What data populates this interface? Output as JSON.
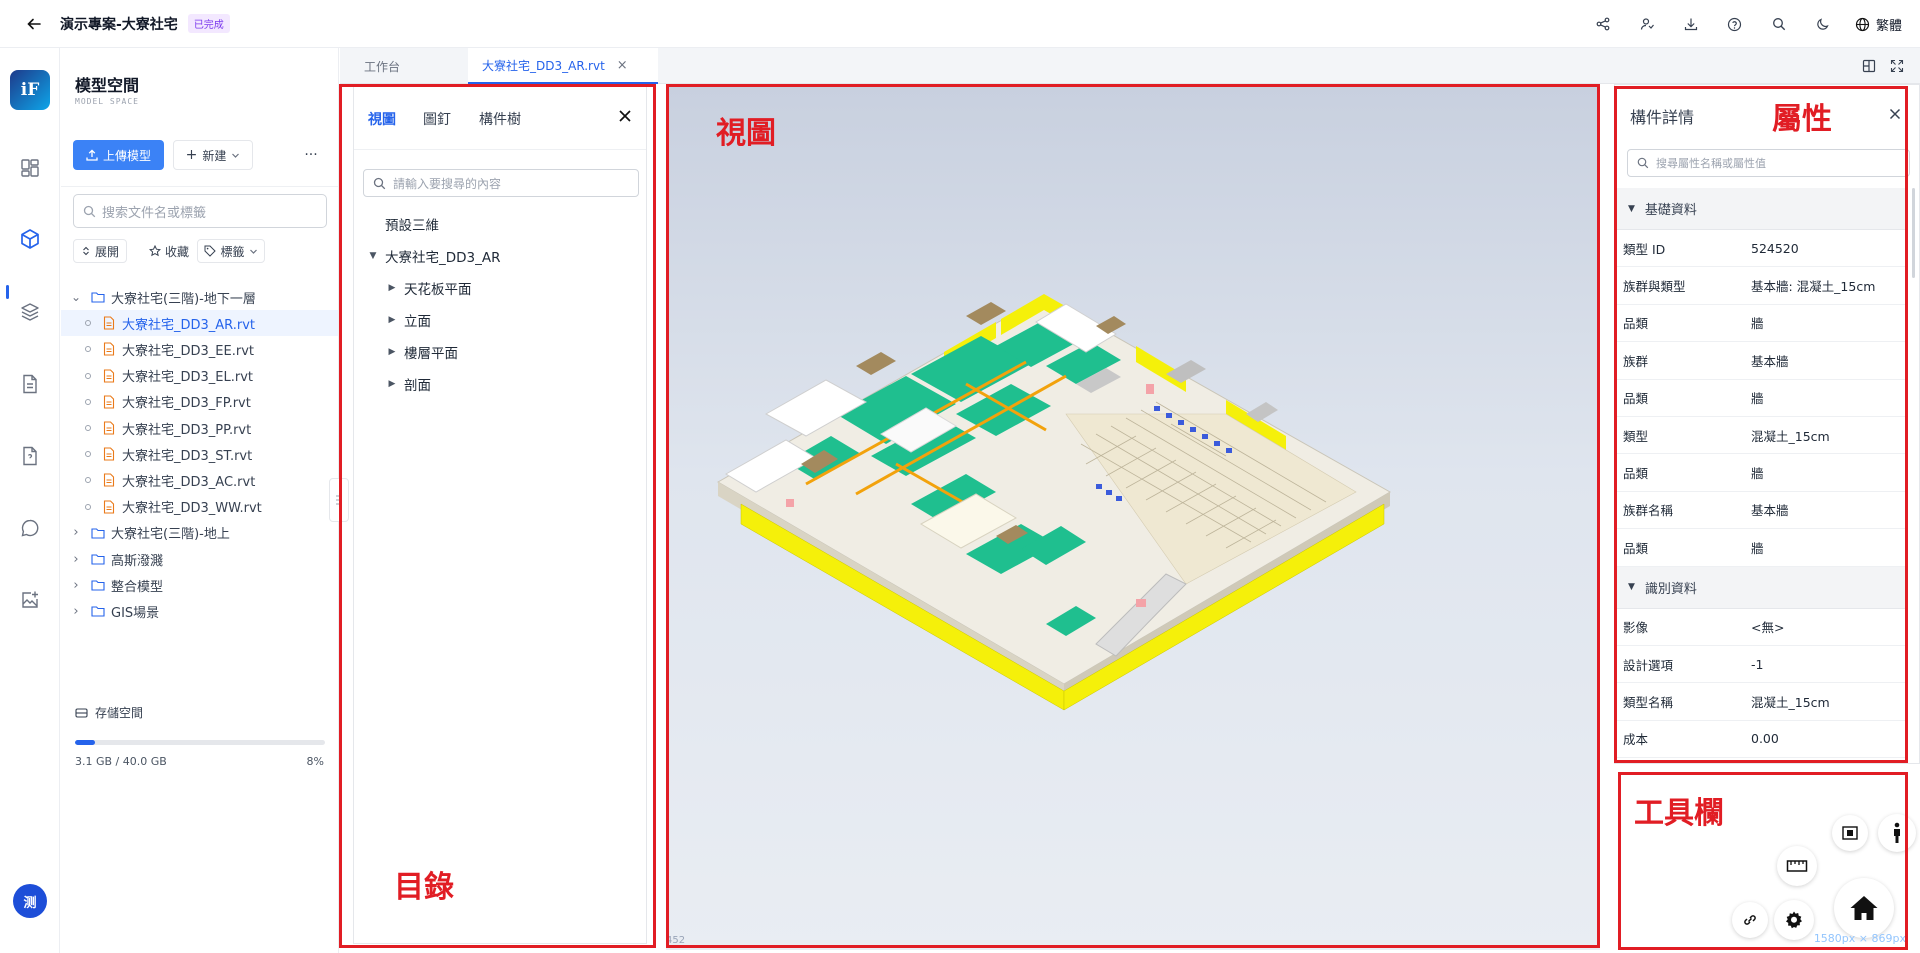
{
  "header": {
    "project_title": "演示專案-大寮社宅",
    "status_badge": "已完成",
    "language": "繁體"
  },
  "rail": {
    "logo_text": "iF",
    "avatar_text": "测"
  },
  "sidebar": {
    "title": "模型空間",
    "subtitle": "MODEL SPACE",
    "upload_label": "上傳模型",
    "new_label": "新建",
    "more_label": "···",
    "search_placeholder": "搜索文件名或標籤",
    "chips": [
      "展開",
      "收藏",
      "標籤"
    ],
    "tree": [
      {
        "label": "大寮社宅(三階)-地下一層",
        "type": "folder",
        "expanded": true
      },
      {
        "label": "大寮社宅_DD3_AR.rvt",
        "type": "file",
        "selected": true
      },
      {
        "label": "大寮社宅_DD3_EE.rvt",
        "type": "file"
      },
      {
        "label": "大寮社宅_DD3_EL.rvt",
        "type": "file"
      },
      {
        "label": "大寮社宅_DD3_FP.rvt",
        "type": "file"
      },
      {
        "label": "大寮社宅_DD3_PP.rvt",
        "type": "file"
      },
      {
        "label": "大寮社宅_DD3_ST.rvt",
        "type": "file"
      },
      {
        "label": "大寮社宅_DD3_AC.rvt",
        "type": "file"
      },
      {
        "label": "大寮社宅_DD3_WW.rvt",
        "type": "file"
      },
      {
        "label": "大寮社宅(三階)-地上",
        "type": "folder"
      },
      {
        "label": "高斯潑濺",
        "type": "folder"
      },
      {
        "label": "整合模型",
        "type": "folder"
      },
      {
        "label": "GIS場景",
        "type": "folder"
      }
    ],
    "storage_label": "存儲空間",
    "storage_used": "3.1 GB / 40.0 GB",
    "storage_percent": "8%",
    "storage_fraction": 0.08
  },
  "tabs": [
    {
      "label": "工作台",
      "active": false
    },
    {
      "label": "大寮社宅_DD3_AR.rvt",
      "active": true
    }
  ],
  "directory": {
    "tabs": [
      "視圖",
      "圖釘",
      "構件樹"
    ],
    "search_placeholder": "請輸入要搜尋的內容",
    "items": [
      {
        "label": "預設三維",
        "level": 0,
        "caret": ""
      },
      {
        "label": "大寮社宅_DD3_AR",
        "level": 0,
        "caret": "expanded"
      },
      {
        "label": "天花板平面",
        "level": 1,
        "caret": "collapsed"
      },
      {
        "label": "立面",
        "level": 1,
        "caret": "collapsed"
      },
      {
        "label": "樓層平面",
        "level": 1,
        "caret": "collapsed"
      },
      {
        "label": "剖面",
        "level": 1,
        "caret": "collapsed"
      }
    ]
  },
  "viewport": {
    "coord_text": "452"
  },
  "properties": {
    "title": "構件詳情",
    "search_placeholder": "搜尋屬性名稱或屬性值",
    "groups": [
      {
        "name": "基礎資料",
        "rows": [
          {
            "key": "類型 ID",
            "value": "524520"
          },
          {
            "key": "族群與類型",
            "value": "基本牆: 混凝土_15cm"
          },
          {
            "key": "品類",
            "value": "牆"
          },
          {
            "key": "族群",
            "value": "基本牆"
          },
          {
            "key": "品類",
            "value": "牆"
          },
          {
            "key": "類型",
            "value": "混凝土_15cm"
          },
          {
            "key": "品類",
            "value": "牆"
          },
          {
            "key": "族群名稱",
            "value": "基本牆"
          },
          {
            "key": "品類",
            "value": "牆"
          }
        ]
      },
      {
        "name": "識別資料",
        "rows": [
          {
            "key": "影像",
            "value": "<無>"
          },
          {
            "key": "設計選項",
            "value": "-1"
          },
          {
            "key": "類型名稱",
            "value": "混凝土_15cm"
          },
          {
            "key": "成本",
            "value": "0.00"
          }
        ]
      }
    ]
  },
  "toolbar": {
    "size_label": "1580px × 869px"
  },
  "annotations": {
    "directory": "目錄",
    "view": "視圖",
    "properties": "屬性",
    "toolbar": "工具欄"
  },
  "colors": {
    "accent": "#2563eb",
    "annotation_red": "#e11d24",
    "model_floor_green": "#1fbf8f",
    "model_wall_yellow": "#f5f00a"
  }
}
